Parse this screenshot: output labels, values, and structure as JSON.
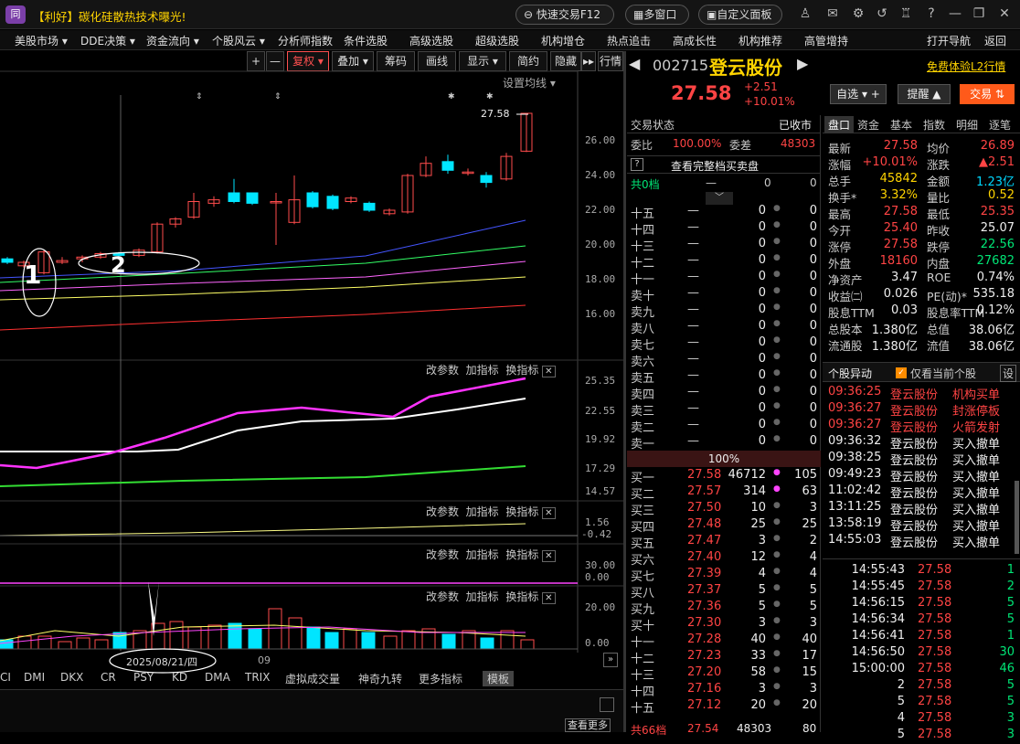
{
  "titlebar": {
    "logo": "同",
    "news": "【利好】碳化硅散热技术曝光!",
    "quick_trade": "快速交易F12",
    "multi_window": "多窗口",
    "custom_panel": "自定义面板"
  },
  "menu": [
    "美股市场 ▾",
    "DDE决策 ▾",
    "资金流向 ▾",
    "个股风云 ▾",
    "分析师指数",
    "条件选股",
    "高级选股",
    "超级选股",
    "机构增仓",
    "热点追击",
    "高成长性",
    "机构推荐",
    "高管增持"
  ],
  "menu_right": {
    "open_nav": "打开导航",
    "back": "返回"
  },
  "chart_toolbar": {
    "plus": "+",
    "minus": "—",
    "fuquan": "复权 ▾",
    "overlay": "叠加 ▾",
    "chips": "筹码",
    "draw": "画线",
    "display": "显示 ▾",
    "simple": "简约",
    "hide": "隐藏",
    "arrows": "▸▸",
    "row": "行情"
  },
  "set_ma": "设置均线 ▾",
  "price_axis": [
    "26.00",
    "24.00",
    "22.00",
    "20.00",
    "18.00",
    "16.00"
  ],
  "last_price_tag": "27.58",
  "annotations": {
    "one": "1",
    "two": "2"
  },
  "ind_panel": {
    "param": "改参数",
    "add": "加指标",
    "switch": "换指标",
    "close": "✕"
  },
  "ind1_axis": [
    "25.35",
    "22.55",
    "19.92",
    "17.29",
    "14.57"
  ],
  "ind2_axis": [
    "1.56",
    "-0.42"
  ],
  "ind3_axis": [
    "30.00",
    "0.00"
  ],
  "ind4_axis": [
    "20.00",
    "0.00"
  ],
  "date_label": "2025/08/21/四",
  "month_label": "09",
  "bottom_tabs": [
    "CI",
    "DMI",
    "DKX",
    "CR",
    "PSY",
    "KD",
    "DMA",
    "TRIX",
    "虚拟成交量",
    "神奇九转",
    "更多指标",
    "模板"
  ],
  "stock": {
    "code": "002715",
    "name": "登云股份",
    "price": "27.58",
    "change": "+2.51",
    "pct": "+10.01%",
    "l2": "免费体验L2行情",
    "zixuan": "自选 ▾ +",
    "tixing": "提醒 ▲",
    "jiaoyi": "交易 ⇅"
  },
  "trade_status": {
    "label": "交易状态",
    "value": "已收市"
  },
  "weibi": {
    "label": "委比",
    "value": "100.00%",
    "wc_label": "委差",
    "wc_value": "48303"
  },
  "full_book": "查看完整档买卖盘",
  "gong": {
    "label": "共0档",
    "dash": "—",
    "v1": "0",
    "v2": "0"
  },
  "sell_levels": [
    {
      "n": "十五",
      "p": "—",
      "v": "0",
      "c": "0"
    },
    {
      "n": "十四",
      "p": "—",
      "v": "0",
      "c": "0"
    },
    {
      "n": "十三",
      "p": "—",
      "v": "0",
      "c": "0"
    },
    {
      "n": "十二",
      "p": "—",
      "v": "0",
      "c": "0"
    },
    {
      "n": "十一",
      "p": "—",
      "v": "0",
      "c": "0"
    },
    {
      "n": "卖十",
      "p": "—",
      "v": "0",
      "c": "0"
    },
    {
      "n": "卖九",
      "p": "—",
      "v": "0",
      "c": "0"
    },
    {
      "n": "卖八",
      "p": "—",
      "v": "0",
      "c": "0"
    },
    {
      "n": "卖七",
      "p": "—",
      "v": "0",
      "c": "0"
    },
    {
      "n": "卖六",
      "p": "—",
      "v": "0",
      "c": "0"
    },
    {
      "n": "卖五",
      "p": "—",
      "v": "0",
      "c": "0"
    },
    {
      "n": "卖四",
      "p": "—",
      "v": "0",
      "c": "0"
    },
    {
      "n": "卖三",
      "p": "—",
      "v": "0",
      "c": "0"
    },
    {
      "n": "卖二",
      "p": "—",
      "v": "0",
      "c": "0"
    },
    {
      "n": "卖一",
      "p": "—",
      "v": "0",
      "c": "0"
    }
  ],
  "mid_pct": "100%",
  "buy_levels": [
    {
      "n": "买一",
      "p": "27.58",
      "v": "46712",
      "c": "105",
      "dot": true
    },
    {
      "n": "买二",
      "p": "27.57",
      "v": "314",
      "c": "63",
      "dot": true
    },
    {
      "n": "买三",
      "p": "27.50",
      "v": "10",
      "c": "3"
    },
    {
      "n": "买四",
      "p": "27.48",
      "v": "25",
      "c": "25"
    },
    {
      "n": "买五",
      "p": "27.47",
      "v": "3",
      "c": "2"
    },
    {
      "n": "买六",
      "p": "27.40",
      "v": "12",
      "c": "4"
    },
    {
      "n": "买七",
      "p": "27.39",
      "v": "4",
      "c": "4"
    },
    {
      "n": "买八",
      "p": "27.37",
      "v": "5",
      "c": "5"
    },
    {
      "n": "买九",
      "p": "27.36",
      "v": "5",
      "c": "5"
    },
    {
      "n": "买十",
      "p": "27.30",
      "v": "3",
      "c": "3"
    },
    {
      "n": "十一",
      "p": "27.28",
      "v": "40",
      "c": "40"
    },
    {
      "n": "十二",
      "p": "27.23",
      "v": "33",
      "c": "17"
    },
    {
      "n": "十三",
      "p": "27.20",
      "v": "58",
      "c": "15"
    },
    {
      "n": "十四",
      "p": "27.16",
      "v": "3",
      "c": "3"
    },
    {
      "n": "十五",
      "p": "27.12",
      "v": "20",
      "c": "20"
    }
  ],
  "gong_bottom": {
    "label": "共66档",
    "p": "27.54",
    "v": "48303",
    "c": "80"
  },
  "right_tabs": [
    "盘口",
    "资金",
    "基本",
    "指数",
    "明细",
    "逐笔"
  ],
  "quote": [
    [
      "最新",
      "27.58",
      "r",
      "均价",
      "26.89",
      "r"
    ],
    [
      "涨幅",
      "+10.01%",
      "r",
      "涨跌",
      "▲2.51",
      "r"
    ],
    [
      "总手",
      "45842",
      "y",
      "金额",
      "1.23亿",
      "c"
    ],
    [
      "换手*",
      "3.32%",
      "y",
      "量比",
      "0.52",
      "y"
    ],
    [
      "最高",
      "27.58",
      "r",
      "最低",
      "25.35",
      "r"
    ],
    [
      "今开",
      "25.40",
      "r",
      "昨收",
      "25.07",
      "w"
    ],
    [
      "涨停",
      "27.58",
      "r",
      "跌停",
      "22.56",
      "g"
    ],
    [
      "外盘",
      "18160",
      "r",
      "内盘",
      "27682",
      "g"
    ],
    [
      "净资产",
      "3.47",
      "w",
      "ROE",
      "0.74%",
      "w"
    ],
    [
      "收益㈡",
      "0.026",
      "w",
      "PE(动)*",
      "535.18",
      "w"
    ],
    [
      "股息TTM",
      "0.03",
      "w",
      "股息率TTM",
      "0.12%",
      "w"
    ],
    [
      "总股本",
      "1.380亿",
      "w",
      "总值",
      "38.06亿",
      "w"
    ],
    [
      "流通股",
      "1.380亿",
      "w",
      "流值",
      "38.06亿",
      "w"
    ]
  ],
  "abnormal": {
    "title": "个股异动",
    "only_current": "仅看当前个股",
    "settings": "设"
  },
  "alerts": [
    {
      "t": "09:36:25",
      "s": "登云股份",
      "e": "机构买单",
      "hot": true
    },
    {
      "t": "09:36:27",
      "s": "登云股份",
      "e": "封涨停板",
      "hot": true
    },
    {
      "t": "09:36:27",
      "s": "登云股份",
      "e": "火箭发射",
      "hot": true
    },
    {
      "t": "09:36:32",
      "s": "登云股份",
      "e": "买入撤单"
    },
    {
      "t": "09:38:25",
      "s": "登云股份",
      "e": "买入撤单"
    },
    {
      "t": "09:49:23",
      "s": "登云股份",
      "e": "买入撤单"
    },
    {
      "t": "11:02:42",
      "s": "登云股份",
      "e": "买入撤单"
    },
    {
      "t": "13:11:25",
      "s": "登云股份",
      "e": "买入撤单"
    },
    {
      "t": "13:58:19",
      "s": "登云股份",
      "e": "买入撤单"
    },
    {
      "t": "14:55:03",
      "s": "登云股份",
      "e": "买入撤单"
    }
  ],
  "ticks": [
    {
      "t": "14:55:43",
      "p": "27.58",
      "v": "1"
    },
    {
      "t": "14:55:45",
      "p": "27.58",
      "v": "2"
    },
    {
      "t": "14:56:15",
      "p": "27.58",
      "v": "5"
    },
    {
      "t": "14:56:34",
      "p": "27.58",
      "v": "5"
    },
    {
      "t": "14:56:41",
      "p": "27.58",
      "v": "1"
    },
    {
      "t": "14:56:50",
      "p": "27.58",
      "v": "30"
    },
    {
      "t": "15:00:00",
      "p": "27.58",
      "v": "46"
    },
    {
      "t": "2",
      "p": "27.58",
      "v": "5"
    },
    {
      "t": "5",
      "p": "27.58",
      "v": "5"
    },
    {
      "t": "4",
      "p": "27.58",
      "v": "3"
    },
    {
      "t": "5",
      "p": "27.58",
      "v": "3"
    }
  ],
  "more": "查看更多"
}
